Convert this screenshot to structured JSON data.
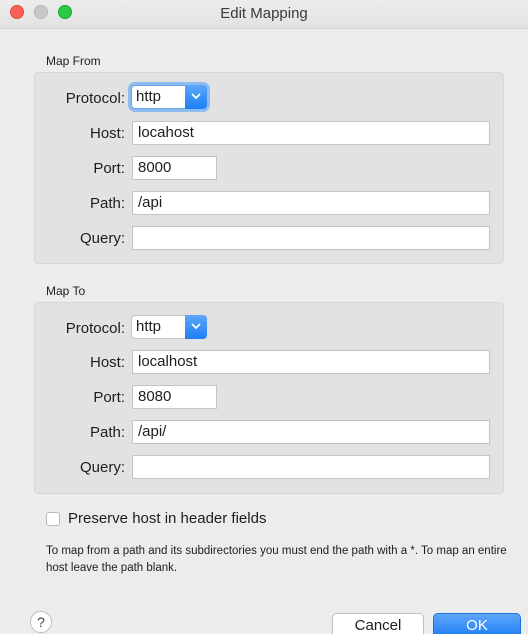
{
  "window": {
    "title": "Edit Mapping"
  },
  "map_from": {
    "section_label": "Map From",
    "protocol_label": "Protocol:",
    "protocol_value": "http",
    "host_label": "Host:",
    "host_value": "locahost",
    "port_label": "Port:",
    "port_value": "8000",
    "path_label": "Path:",
    "path_value": "/api",
    "query_label": "Query:",
    "query_value": ""
  },
  "map_to": {
    "section_label": "Map To",
    "protocol_label": "Protocol:",
    "protocol_value": "http",
    "host_label": "Host:",
    "host_value": "localhost",
    "port_label": "Port:",
    "port_value": "8080",
    "path_label": "Path:",
    "path_value": "/api/",
    "query_label": "Query:",
    "query_value": ""
  },
  "options": {
    "preserve_host_label": "Preserve host in header fields",
    "preserve_host_checked": false
  },
  "hint_text": "To map from a path and its subdirectories you must end the path with a *. To map an entire host leave the path blank.",
  "buttons": {
    "help": "?",
    "cancel": "Cancel",
    "ok": "OK"
  },
  "colors": {
    "accent": "#1c7ff5",
    "close": "#fc5f57",
    "maximize": "#2ac93f"
  }
}
